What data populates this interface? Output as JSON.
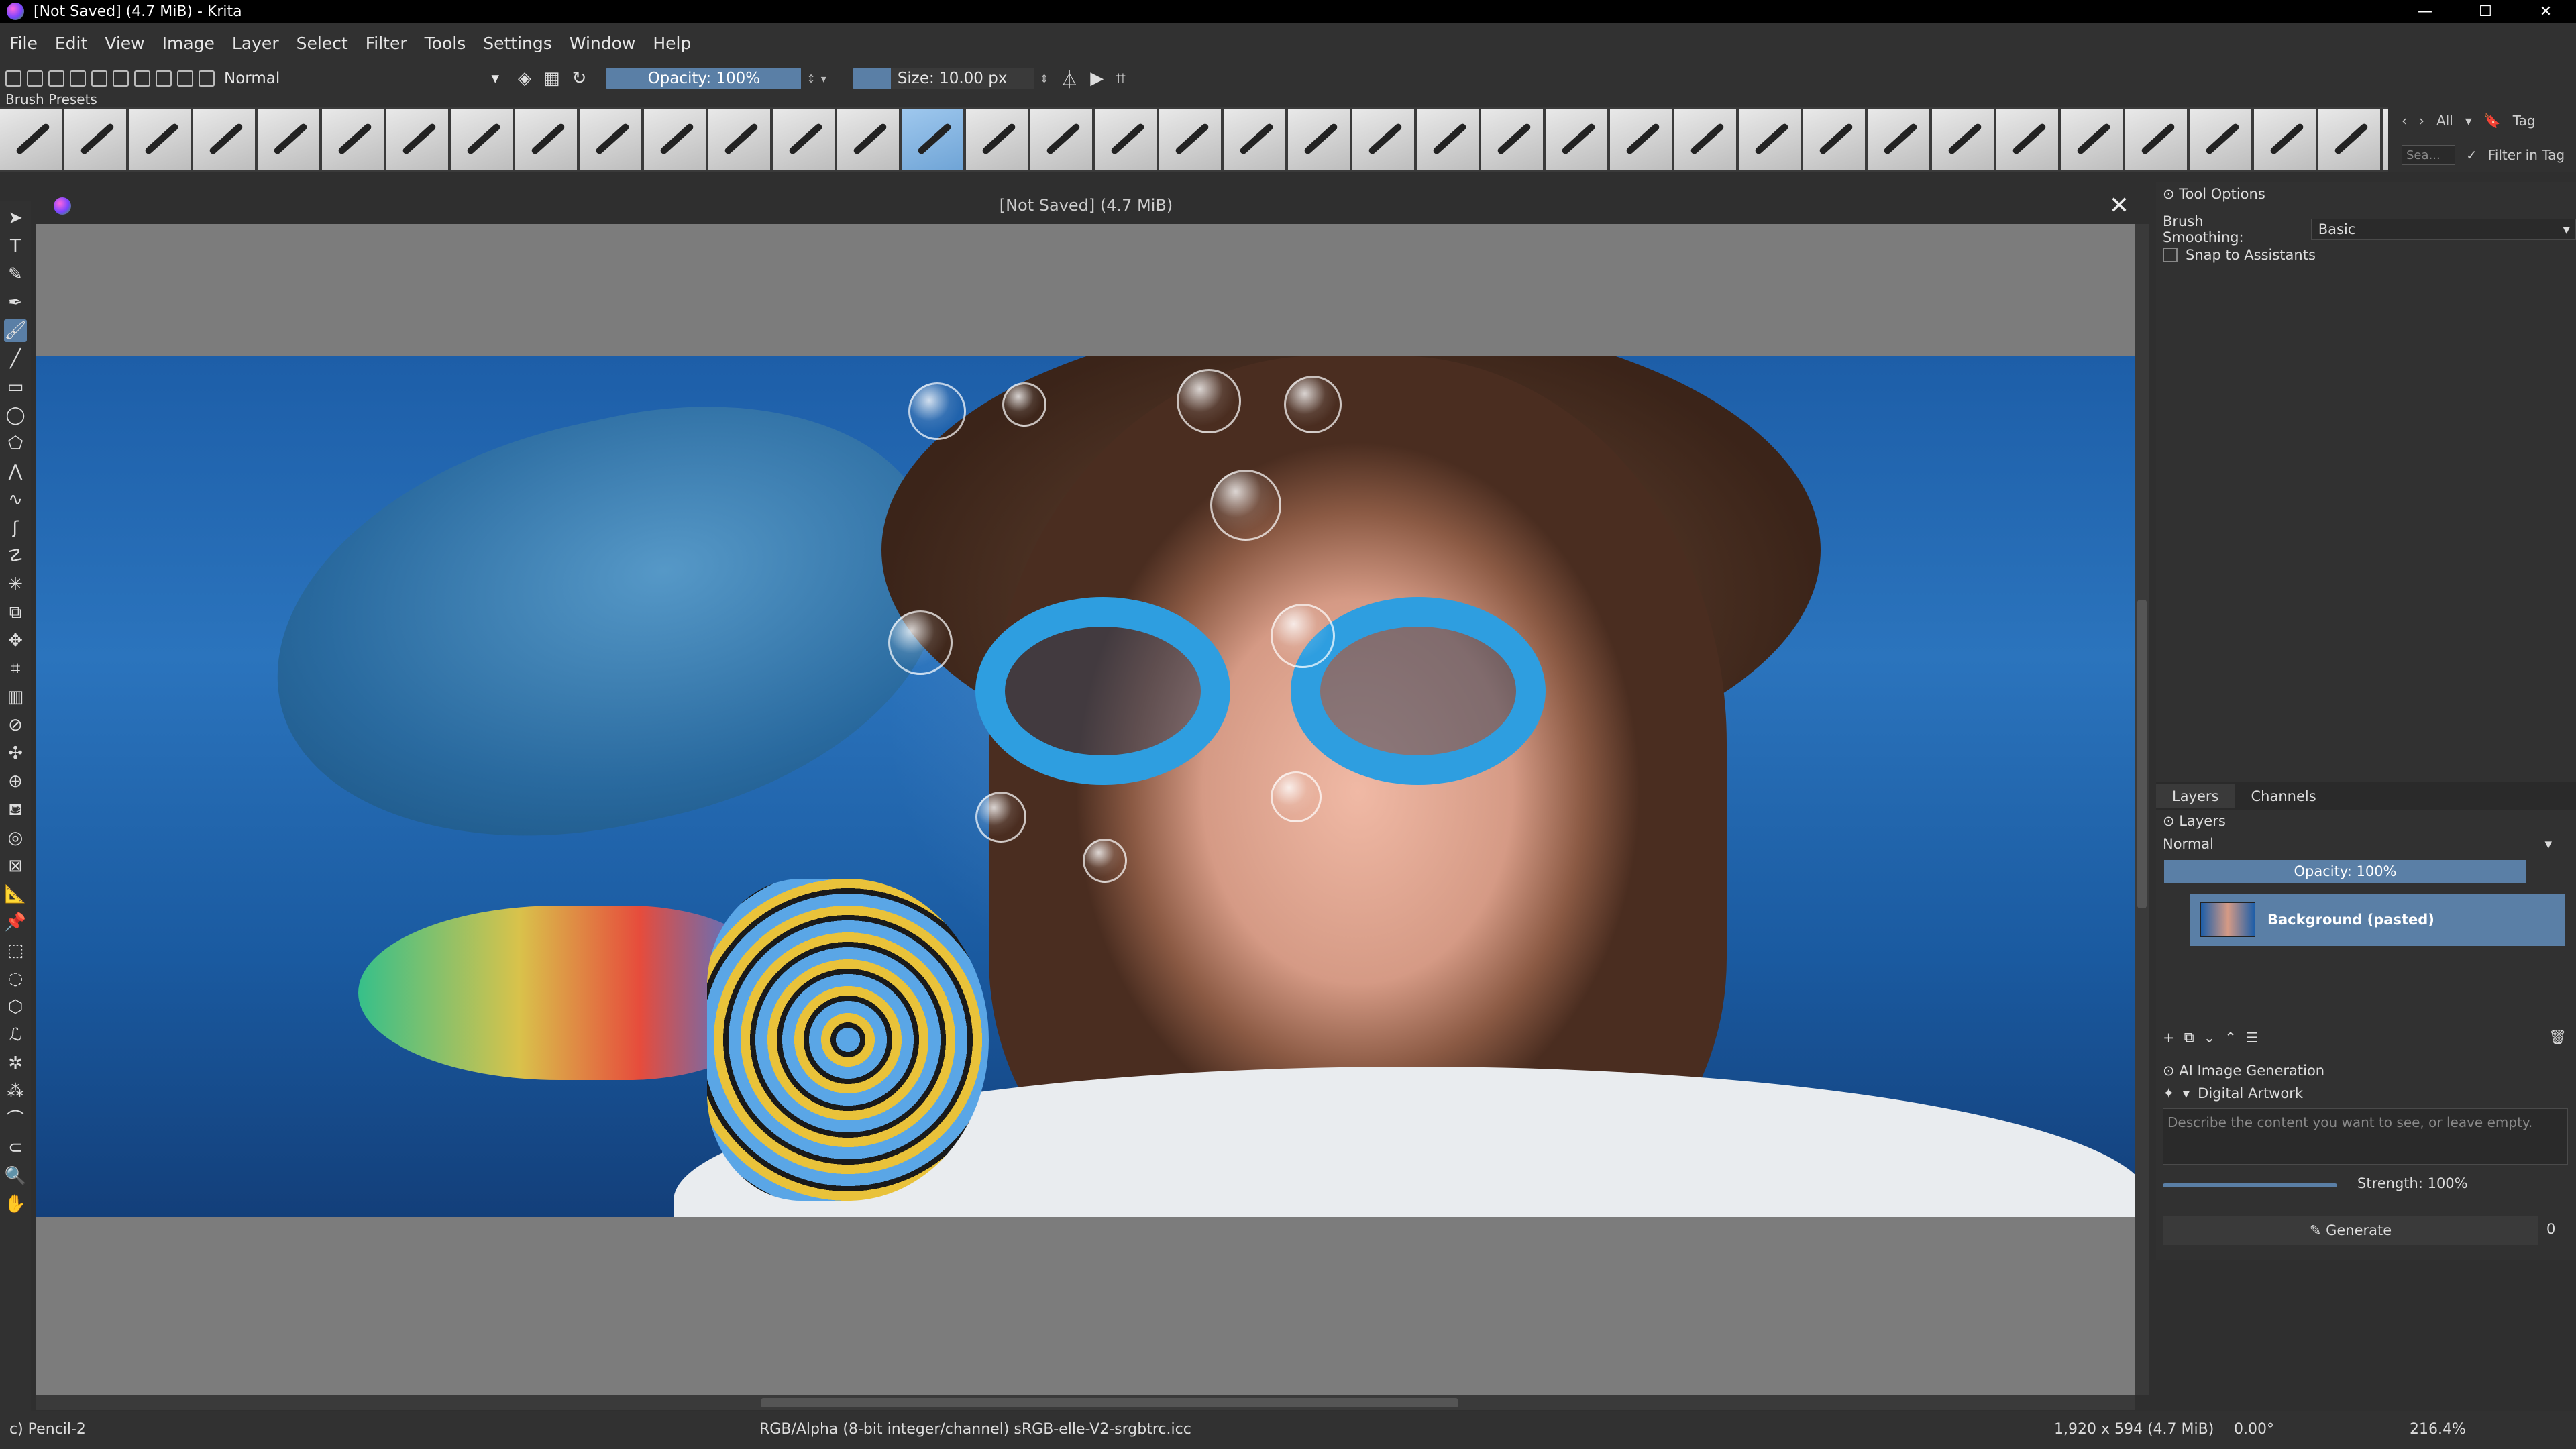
{
  "window": {
    "title": "[Not Saved]  (4.7 MiB)  - Krita",
    "minimize": "—",
    "maximize": "☐",
    "close": "✕"
  },
  "menu": [
    "File",
    "Edit",
    "View",
    "Image",
    "Layer",
    "Select",
    "Filter",
    "Tools",
    "Settings",
    "Window",
    "Help"
  ],
  "toolbar": {
    "blend_mode": "Normal",
    "opacity": "Opacity: 100%",
    "size": "Size: 10.00 px"
  },
  "brush_presets": {
    "title": "Brush Presets",
    "count": 38,
    "selected_index": 14,
    "tag_filter": "All",
    "tag_label": "Tag",
    "search_placeholder": "Sea...",
    "filter_in_tag": "Filter in Tag"
  },
  "canvas": {
    "title": "[Not Saved]  (4.7 MiB)"
  },
  "tool_options": {
    "title": "Tool Options",
    "smoothing_label": "Brush Smoothing:",
    "smoothing_value": "Basic",
    "snap_label": "Snap to Assistants"
  },
  "layers": {
    "tabs": [
      "Layers",
      "Channels"
    ],
    "title": "Layers",
    "blend_mode": "Normal",
    "opacity": "Opacity:  100%",
    "items": [
      {
        "name": "Background (pasted)"
      }
    ]
  },
  "ai": {
    "title": "AI Image Generation",
    "style": "Digital Artwork",
    "prompt_placeholder": "Describe the content you want to see, or leave empty.",
    "strength": "Strength: 100%",
    "strength_fraction": 1.0,
    "generate": "Generate",
    "queue": "0"
  },
  "status": {
    "brush": "c) Pencil-2",
    "color_space": "RGB/Alpha (8-bit integer/channel)  sRGB-elle-V2-srgbtrc.icc",
    "dimensions": "1,920 x 594 (4.7 MiB)",
    "rotation": "0.00°",
    "zoom": "216.4%"
  }
}
